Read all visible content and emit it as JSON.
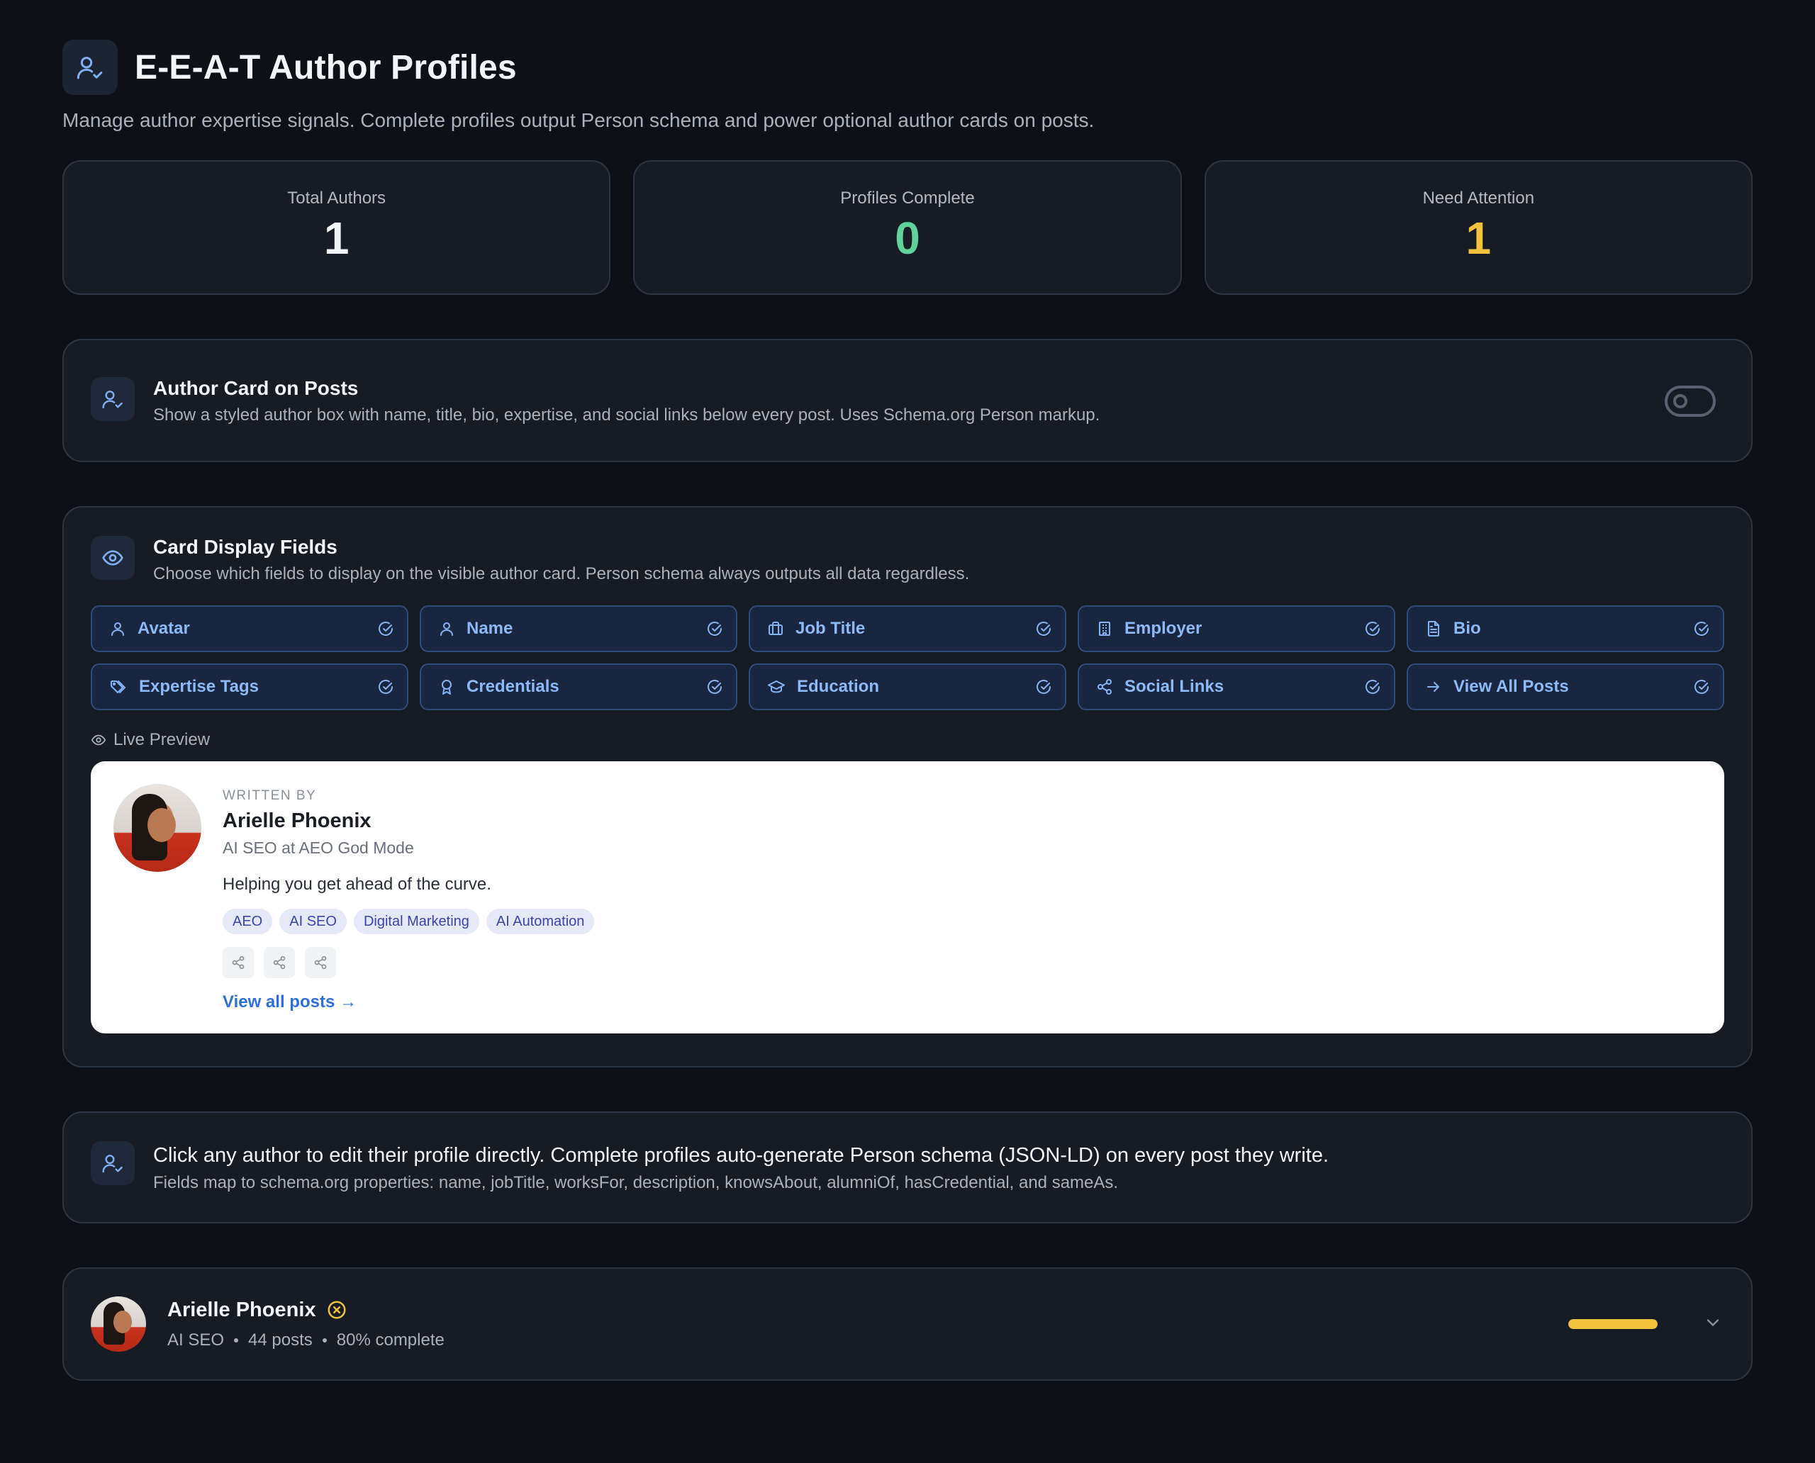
{
  "header": {
    "title": "E-E-A-T Author Profiles",
    "subtitle": "Manage author expertise signals. Complete profiles output Person schema and power optional author cards on posts.",
    "icon": "user-check-icon"
  },
  "stats": [
    {
      "label": "Total Authors",
      "value": "1",
      "color": "#f2f4f8"
    },
    {
      "label": "Profiles Complete",
      "value": "0",
      "color": "#5fd39a"
    },
    {
      "label": "Need Attention",
      "value": "1",
      "color": "#f2c23c"
    }
  ],
  "author_card": {
    "title": "Author Card on Posts",
    "description": "Show a styled author box with name, title, bio, expertise, and social links below every post. Uses Schema.org Person markup.",
    "enabled": false
  },
  "display_fields": {
    "title": "Card Display Fields",
    "description": "Choose which fields to display on the visible author card. Person schema always outputs all data regardless.",
    "fields": [
      {
        "label": "Avatar",
        "icon": "user-icon",
        "checked": true
      },
      {
        "label": "Name",
        "icon": "user-icon",
        "checked": true
      },
      {
        "label": "Job Title",
        "icon": "briefcase-icon",
        "checked": true
      },
      {
        "label": "Employer",
        "icon": "building-icon",
        "checked": true
      },
      {
        "label": "Bio",
        "icon": "document-icon",
        "checked": true
      },
      {
        "label": "Expertise Tags",
        "icon": "tags-icon",
        "checked": true
      },
      {
        "label": "Credentials",
        "icon": "award-icon",
        "checked": true
      },
      {
        "label": "Education",
        "icon": "graduation-cap-icon",
        "checked": true
      },
      {
        "label": "Social Links",
        "icon": "share-icon",
        "checked": true
      },
      {
        "label": "View All Posts",
        "icon": "arrow-right-icon",
        "checked": true
      }
    ],
    "live_preview_label": "Live Preview"
  },
  "preview": {
    "written_by": "WRITTEN BY",
    "name": "Arielle Phoenix",
    "role": "AI SEO at AEO God Mode",
    "bio": "Helping you get ahead of the curve.",
    "tags": [
      "AEO",
      "AI SEO",
      "Digital Marketing",
      "AI Automation"
    ],
    "socials": [
      "share-icon",
      "share-icon",
      "share-icon"
    ],
    "link": "View all posts →"
  },
  "info": {
    "title": "Click any author to edit their profile directly. Complete profiles auto-generate Person schema (JSON-LD) on every post they write.",
    "description": "Fields map to schema.org properties: name, jobTitle, worksFor, description, knowsAbout, alumniOf, hasCredential, and sameAs."
  },
  "authors": [
    {
      "name": "Arielle Phoenix",
      "status_icon": "x-circle-icon",
      "role": "AI SEO",
      "posts": "44 posts",
      "completion": "80% complete",
      "progress": 1.0,
      "progress_color": "#f2c23c"
    }
  ]
}
